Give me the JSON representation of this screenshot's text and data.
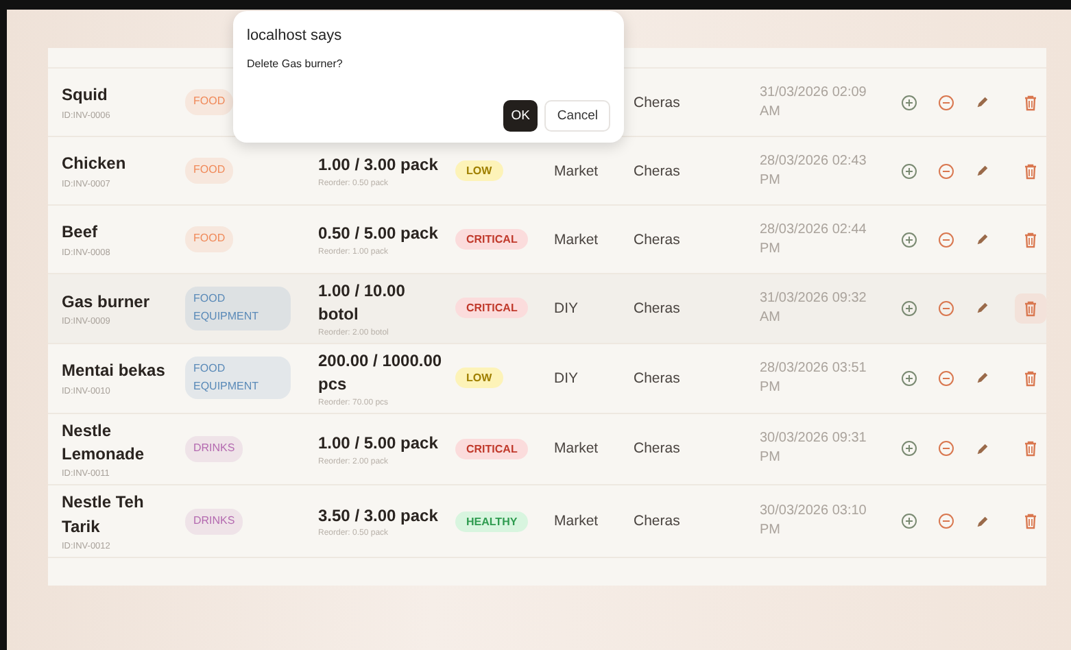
{
  "dialog": {
    "title": "localhost says",
    "message": "Delete Gas burner?",
    "buttons": [
      {
        "label": "OK",
        "kind": "primary"
      },
      {
        "label": "Cancel",
        "kind": "secondary"
      }
    ]
  },
  "rows": [
    {
      "name": "Squid",
      "id": "ID:INV-0006",
      "categories": [
        {
          "label": "FOOD",
          "color": "#f08a5a"
        }
      ],
      "location": "Cheras",
      "updated": "31/03/2026 02:09 AM",
      "selected": false
    },
    {
      "name": "Chicken",
      "id": "ID:INV-0007",
      "categories": [
        {
          "label": "FOOD",
          "color": "#f08a5a"
        }
      ],
      "stock": "1.00 / 3.00 pack",
      "reorder": "Reorder: 0.50 pack",
      "status": {
        "label": "LOW",
        "kind": "low"
      },
      "supplier": "Market",
      "location": "Cheras",
      "updated": "28/03/2026 02:43 PM",
      "selected": false
    },
    {
      "name": "Beef",
      "id": "ID:INV-0008",
      "categories": [
        {
          "label": "FOOD",
          "color": "#f08a5a"
        }
      ],
      "stock": "0.50 / 5.00 pack",
      "reorder": "Reorder: 1.00 pack",
      "status": {
        "label": "CRITICAL",
        "kind": "critical"
      },
      "supplier": "Market",
      "location": "Cheras",
      "updated": "28/03/2026 02:44 PM",
      "selected": false
    },
    {
      "name": "Gas burner",
      "id": "ID:INV-0009",
      "categories": [
        {
          "label": "FOOD EQUIPMENT",
          "color": "#5a8ab8"
        }
      ],
      "stock": "1.00 / 10.00 botol",
      "reorder": "Reorder: 2.00 botol",
      "status": {
        "label": "CRITICAL",
        "kind": "critical"
      },
      "supplier": "DIY",
      "location": "Cheras",
      "updated": "31/03/2026 09:32 AM",
      "selected": true
    },
    {
      "name": "Mentai bekas",
      "id": "ID:INV-0010",
      "categories": [
        {
          "label": "FOOD EQUIPMENT",
          "color": "#5a8ab8"
        }
      ],
      "stock": "200.00 / 1000.00 pcs",
      "reorder": "Reorder: 70.00 pcs",
      "status": {
        "label": "LOW",
        "kind": "low"
      },
      "supplier": "DIY",
      "location": "Cheras",
      "updated": "28/03/2026 03:51 PM",
      "selected": false
    },
    {
      "name": "Nestle Lemonade",
      "id": "ID:INV-0011",
      "categories": [
        {
          "label": "DRINKS",
          "color": "#b46ab0"
        }
      ],
      "stock": "1.00 / 5.00 pack",
      "reorder": "Reorder: 2.00 pack",
      "status": {
        "label": "CRITICAL",
        "kind": "critical"
      },
      "supplier": "Market",
      "location": "Cheras",
      "updated": "30/03/2026 09:31 PM",
      "selected": false
    },
    {
      "name": "Nestle Teh Tarik",
      "id": "ID:INV-0012",
      "categories": [
        {
          "label": "DRINKS",
          "color": "#b46ab0"
        }
      ],
      "stock": "3.50 / 3.00 pack",
      "reorder": "Reorder: 0.50 pack",
      "status": {
        "label": "HEALTHY",
        "kind": "healthy"
      },
      "supplier": "Market",
      "location": "Cheras",
      "updated": "30/03/2026 03:10 PM",
      "selected": false
    }
  ]
}
